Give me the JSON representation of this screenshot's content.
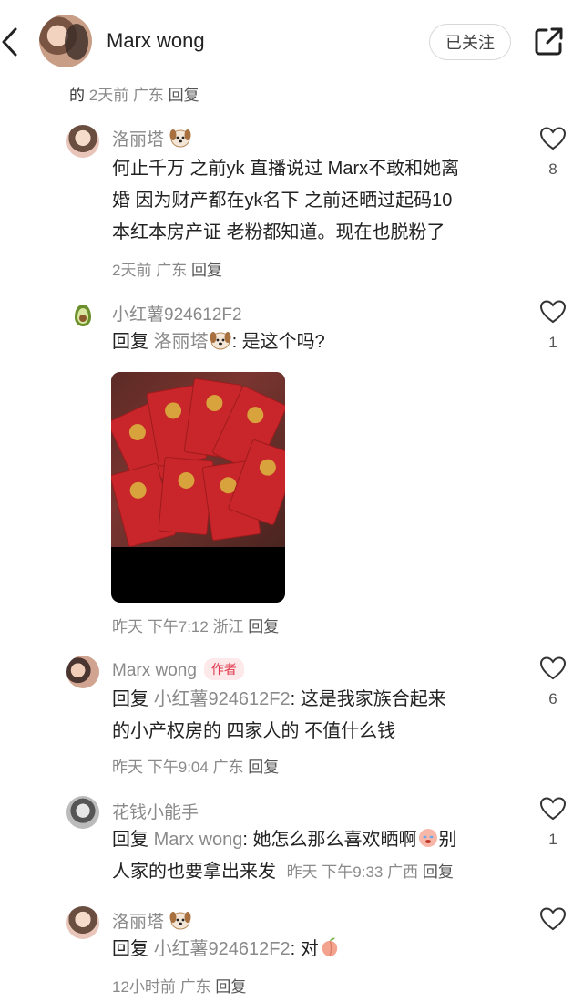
{
  "header": {
    "back_icon": "chevron-left-icon",
    "user_name": "Marx wong",
    "follow_label": "已关注",
    "share_icon": "share-icon"
  },
  "top_meta": {
    "lead": "的",
    "time": "2天前",
    "location": "广东",
    "reply": "回复"
  },
  "comments": [
    {
      "user": "洛丽塔",
      "text_lines": [
        "何止千万 之前yk 直播说过 Marx不敢和她离",
        "婚 因为财产都在yk名下 之前还晒过起码10",
        "本红本房产证 老粉都知道。现在也脱粉了"
      ],
      "time": "2天前",
      "location": "广东",
      "reply": "回复",
      "likes": "8"
    },
    {
      "user": "小红薯924612F2",
      "prefix": "回复",
      "reply_to": "洛丽塔",
      "text": ": 是这个吗?",
      "time": "昨天",
      "time2": "下午7:12",
      "location": "浙江",
      "reply": "回复",
      "likes": "1"
    },
    {
      "user": "Marx wong",
      "badge": "作者",
      "prefix": "回复",
      "reply_to": "小红薯924612F2",
      "text_lines": [
        ": 这是我家族合起来",
        "的小产权房的 四家人的 不值什么钱"
      ],
      "time": "昨天",
      "time2": "下午9:04",
      "location": "广东",
      "reply": "回复",
      "likes": "6"
    },
    {
      "user": "花钱小能手",
      "prefix": "回复",
      "reply_to": "Marx wong",
      "text_line1": ": 她怎么那么喜欢晒啊",
      "text_line1b": "别",
      "text_line2": "人家的也要拿出来发",
      "time": "昨天",
      "time2": "下午9:33",
      "location": "广西",
      "reply": "回复",
      "likes": "1"
    },
    {
      "user": "洛丽塔",
      "prefix": "回复",
      "reply_to": "小红薯924612F2",
      "text": ": 对",
      "time": "12小时前",
      "location": "广东",
      "reply": "回复"
    }
  ],
  "colors": {
    "meta_gray": "#8a8a8a",
    "author_badge": "#e0384b",
    "envelope_red": "#c8262a"
  },
  "icons": [
    "chevron-left-icon",
    "share-icon",
    "heart-icon",
    "dog-emoji-icon",
    "avocado-icon"
  ]
}
